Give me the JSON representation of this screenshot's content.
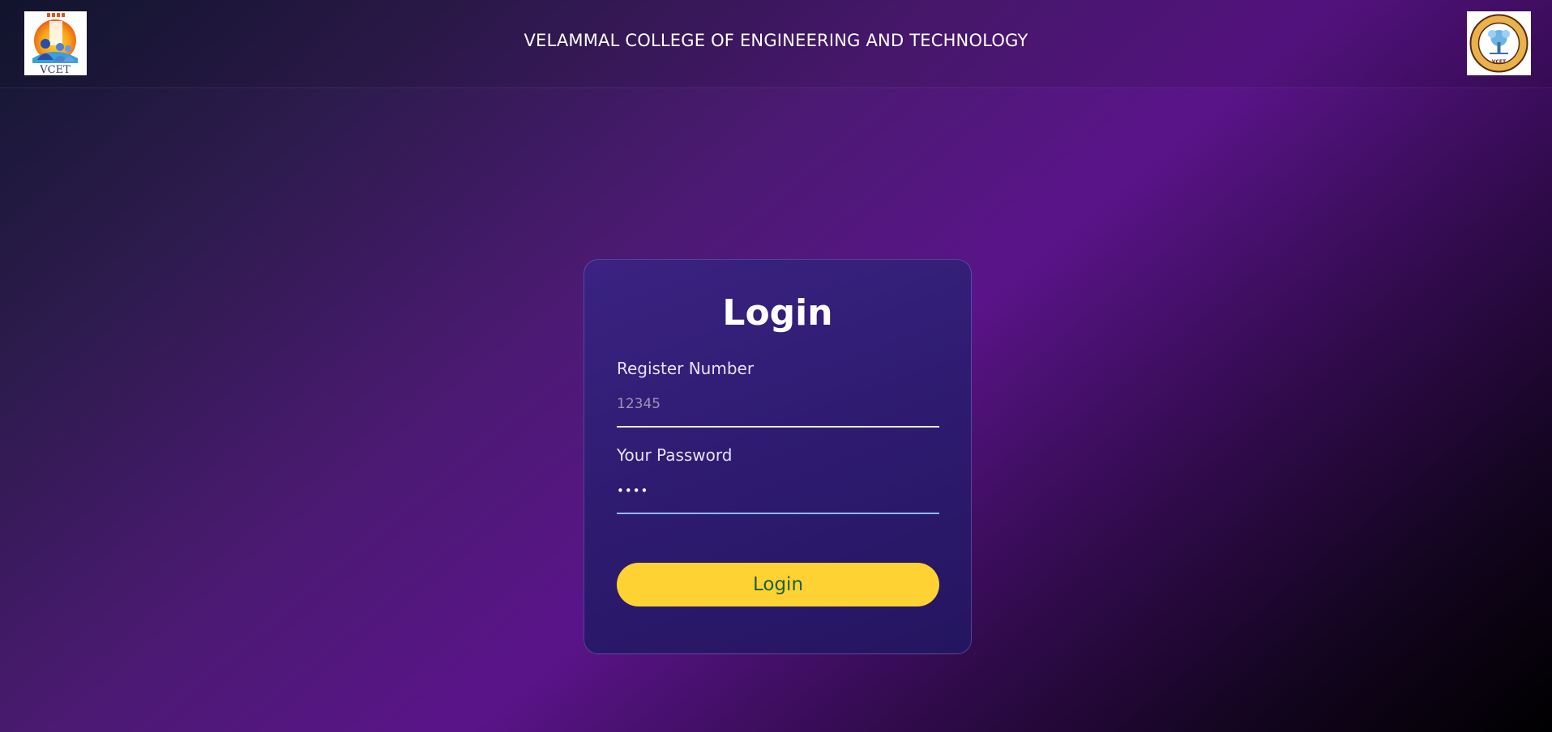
{
  "header": {
    "title": "VELAMMAL COLLEGE OF ENGINEERING AND TECHNOLOGY",
    "left_logo_text": "VCET",
    "right_logo_text": "VCET"
  },
  "login_card": {
    "heading": "Login",
    "register_label": "Register Number",
    "register_placeholder": "12345",
    "password_label": "Your Password",
    "password_value": "••••",
    "submit_label": "Login"
  },
  "colors": {
    "accent_button": "#fdd232",
    "button_text": "#1f5f36",
    "focus_underline": "#8fb8ff"
  }
}
